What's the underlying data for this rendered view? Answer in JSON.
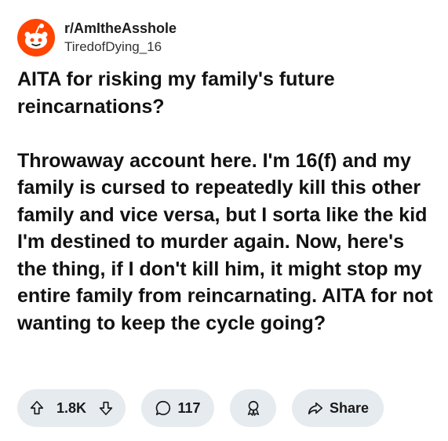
{
  "post": {
    "subreddit": "r/AmItheAsshole",
    "username": "TiredofDying_16",
    "body": "AITA for risking my family's future reincarnations?\n\nThrowaway account here. I'm 16(f) and my family is cursed to repeatedly kill this other family and vice versa, but I sorta like the kid I'm destined to murder again. Now, here's the thing, if I don't kill him, it might stop my entire family from reincarnating. AITA for not wanting to keep the cycle going?"
  },
  "actions": {
    "vote_count": "1.8K",
    "comment_count": "117",
    "share_label": "Share"
  },
  "icons": {
    "avatar": "reddit-snoo-icon",
    "upvote": "arrow-up-icon",
    "downvote": "arrow-down-icon",
    "comment": "comment-bubble-icon",
    "award": "award-icon",
    "share": "share-arrow-icon"
  },
  "colors": {
    "brand": "#ff4500",
    "pill_background": "#e5ebee"
  }
}
